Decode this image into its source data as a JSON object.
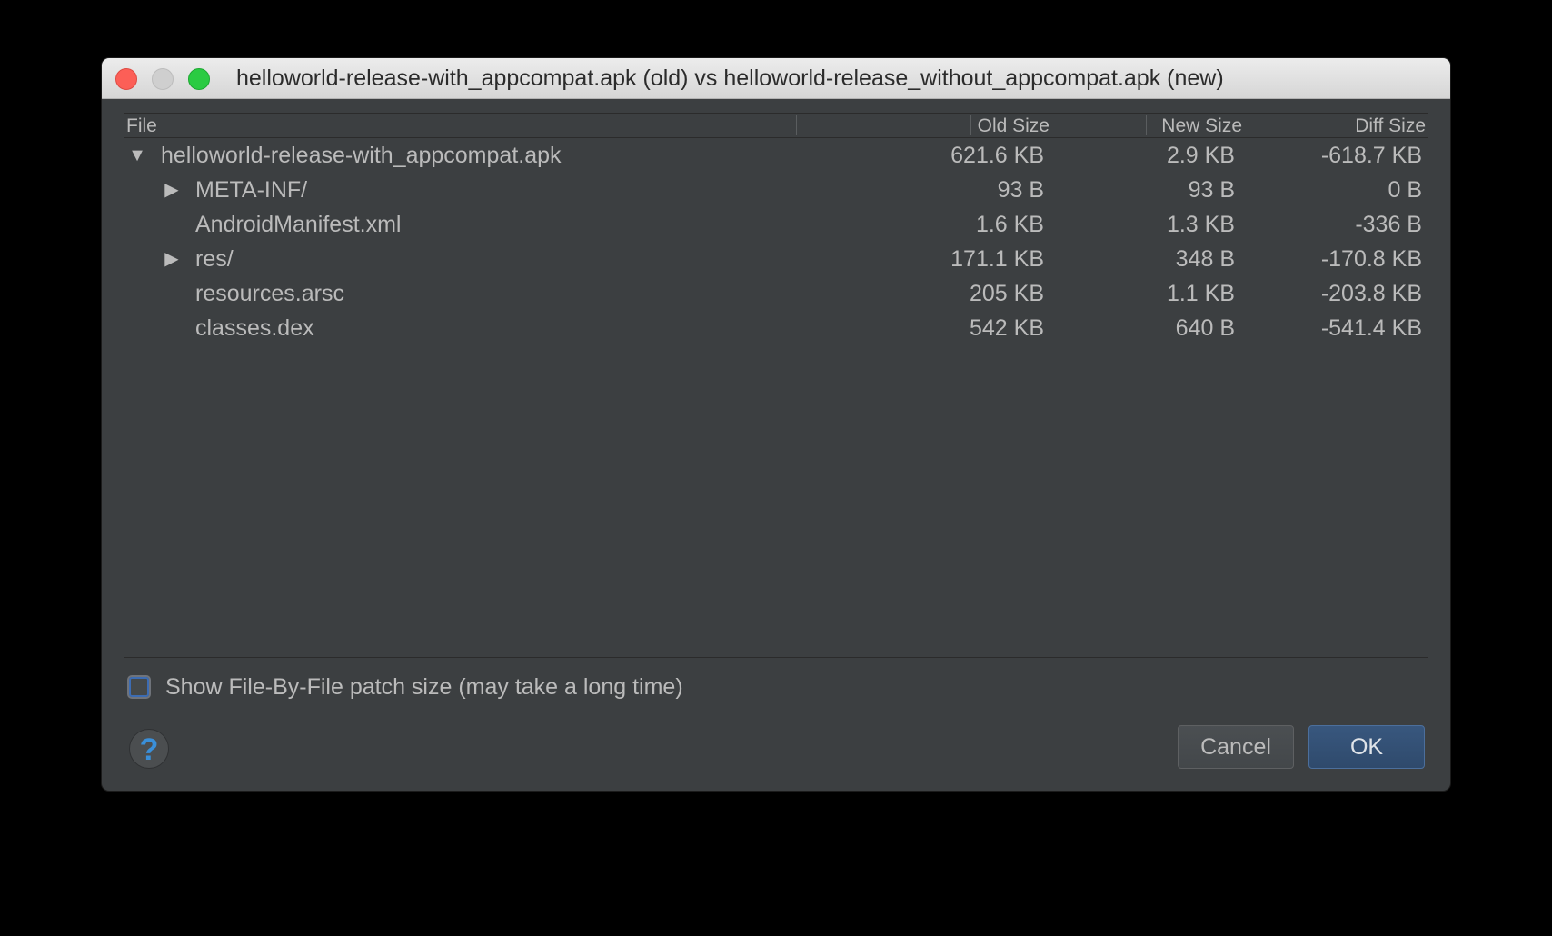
{
  "window": {
    "title": "helloworld-release-with_appcompat.apk (old) vs helloworld-release_without_appcompat.apk (new)"
  },
  "table": {
    "columns": {
      "file": "File",
      "old_size": "Old Size",
      "new_size": "New Size",
      "diff_size": "Diff Size"
    },
    "rows": [
      {
        "arrow": "▼",
        "name": "helloworld-release-with_appcompat.apk",
        "old": "621.6 KB",
        "new": "2.9 KB",
        "diff": "-618.7 KB"
      },
      {
        "arrow": "▶",
        "name": "META-INF/",
        "old": "93 B",
        "new": "93 B",
        "diff": "0 B"
      },
      {
        "arrow": "",
        "name": "AndroidManifest.xml",
        "old": "1.6 KB",
        "new": "1.3 KB",
        "diff": "-336 B"
      },
      {
        "arrow": "▶",
        "name": "res/",
        "old": "171.1 KB",
        "new": "348 B",
        "diff": "-170.8 KB"
      },
      {
        "arrow": "",
        "name": "resources.arsc",
        "old": "205 KB",
        "new": "1.1 KB",
        "diff": "-203.8 KB"
      },
      {
        "arrow": "",
        "name": "classes.dex",
        "old": "542 KB",
        "new": "640 B",
        "diff": "-541.4 KB"
      }
    ]
  },
  "options": {
    "file_by_file_label": "Show File-By-File patch size (may take a long time)",
    "file_by_file_checked": false
  },
  "help": {
    "icon": "help-icon",
    "glyph": "?"
  },
  "buttons": {
    "cancel": "Cancel",
    "ok": "OK"
  },
  "colors": {
    "window_bg": "#3c3f41",
    "text": "#bbbbbb",
    "accent": "#3a8fd9",
    "ok_button": "#2f4a6c",
    "close": "#fc5f57",
    "zoom": "#2acb42"
  }
}
